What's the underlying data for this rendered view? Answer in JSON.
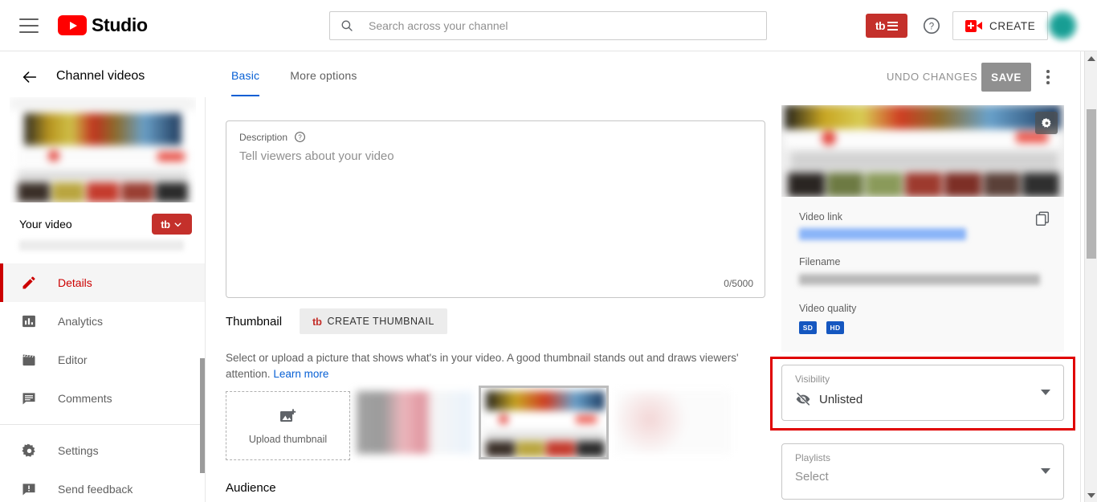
{
  "topbar": {
    "menu_icon": "hamburger-icon",
    "brand": "Studio",
    "search": {
      "placeholder": "Search across your channel",
      "value": "",
      "icon": "search-icon"
    },
    "tubebuddy_button": {
      "mark": "tb",
      "icon": "tubebuddy-menu-icon"
    },
    "help_icon": "help-circle-icon",
    "create_button": {
      "label": "CREATE",
      "icon": "video-camera-plus-icon"
    },
    "avatar": "user-avatar"
  },
  "subheader": {
    "back_icon": "back-arrow-icon",
    "title": "Channel videos",
    "tabs": [
      {
        "label": "Basic",
        "active": true
      },
      {
        "label": "More options",
        "active": false
      }
    ],
    "undo_label": "UNDO CHANGES",
    "save_label": "SAVE",
    "kebab_icon": "more-vertical-icon"
  },
  "sidebar": {
    "video_title": "Your video",
    "tubebuddy_badge": {
      "mark": "tb",
      "icon": "chevron-down-icon"
    },
    "items": [
      {
        "label": "Details",
        "icon": "pencil-icon",
        "active": true
      },
      {
        "label": "Analytics",
        "icon": "bar-chart-icon",
        "active": false
      },
      {
        "label": "Editor",
        "icon": "clapperboard-icon",
        "active": false
      },
      {
        "label": "Comments",
        "icon": "comment-icon",
        "active": false
      },
      {
        "label": "Settings",
        "icon": "gear-icon",
        "active": false
      },
      {
        "label": "Send feedback",
        "icon": "feedback-icon",
        "active": false
      }
    ]
  },
  "main": {
    "description": {
      "label": "Description",
      "help_icon": "help-circle-icon",
      "placeholder": "Tell viewers about your video",
      "value": "",
      "counter": "0/5000"
    },
    "thumbnail": {
      "title": "Thumbnail",
      "create_button": {
        "mark": "tb",
        "label": "CREATE THUMBNAIL"
      },
      "description": "Select or upload a picture that shows what's in your video. A good thumbnail stands out and draws viewers' attention.",
      "learn_more": "Learn more",
      "upload_label": "Upload thumbnail",
      "upload_icon": "add-image-icon"
    },
    "audience_title": "Audience"
  },
  "right_panel": {
    "gear_icon": "gear-icon",
    "video_link_label": "Video link",
    "video_link_value": "",
    "copy_icon": "copy-icon",
    "filename_label": "Filename",
    "filename_value": "",
    "video_quality_label": "Video quality",
    "quality_chips": [
      "SD",
      "HD"
    ],
    "visibility": {
      "label": "Visibility",
      "value": "Unlisted",
      "icon": "eye-off-icon",
      "caret": "chevron-down-icon",
      "highlighted": true
    },
    "playlists": {
      "label": "Playlists",
      "value": "Select",
      "caret": "chevron-down-icon"
    }
  },
  "colors": {
    "youtube_red": "#ff0000",
    "accent_blue": "#065fd4",
    "tubebuddy_red": "#c4302b",
    "active_nav_red": "#cc0000",
    "highlight_red": "#e00000",
    "save_gray": "#909090",
    "quality_blue": "#1557c0"
  }
}
